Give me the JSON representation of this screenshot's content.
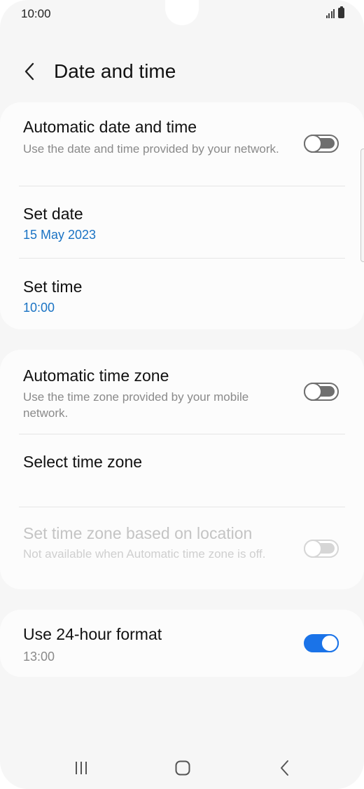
{
  "status_bar": {
    "time": "10:00"
  },
  "header": {
    "title": "Date and time"
  },
  "date_time_card": {
    "automatic_date_time": {
      "title": "Automatic date and time",
      "description": "Use the date and time provided by your network.",
      "enabled": false
    },
    "set_date": {
      "title": "Set date",
      "value": "15 May 2023"
    },
    "set_time": {
      "title": "Set time",
      "value": "10:00"
    }
  },
  "time_zone_card": {
    "automatic_time_zone": {
      "title": "Automatic time zone",
      "description": "Use the time zone provided by your mobile network.",
      "enabled": false
    },
    "select_time_zone": {
      "title": "Select time zone"
    },
    "location_time_zone": {
      "title": "Set time zone based on location",
      "description": "Not available when Automatic time zone is off.",
      "enabled": false,
      "available": false
    }
  },
  "format_card": {
    "use_24_hour": {
      "title": "Use 24-hour format",
      "value": "13:00",
      "enabled": true
    }
  },
  "colors": {
    "accent": "#1a73e8",
    "value_text": "#1a73c4",
    "background": "#f6f6f6",
    "card": "#fcfcfc"
  }
}
